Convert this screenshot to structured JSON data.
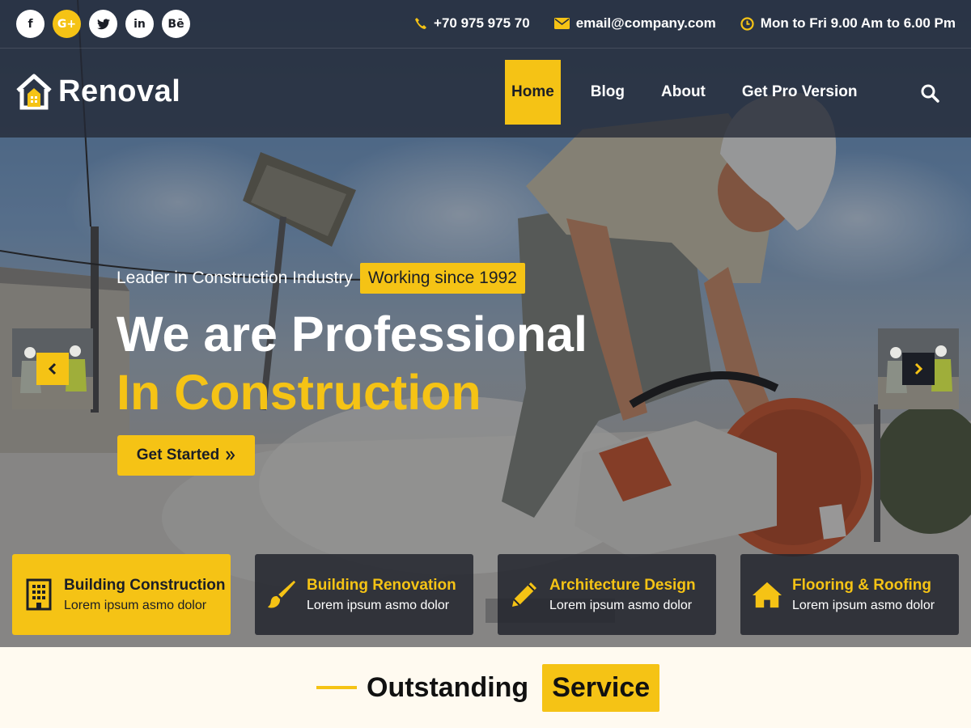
{
  "brand": {
    "name": "Renoval",
    "accent": "#f5c315",
    "dark": "#1b1e26"
  },
  "topbar": {
    "socials": [
      {
        "icon": "facebook-icon",
        "glyph": "f"
      },
      {
        "icon": "google-plus-icon",
        "glyph": "G+"
      },
      {
        "icon": "twitter-icon",
        "glyph": "t"
      },
      {
        "icon": "linkedin-icon",
        "glyph": "in"
      },
      {
        "icon": "behance-icon",
        "glyph": "Bē"
      }
    ],
    "phone": "+70 975 975 70",
    "email": "email@company.com",
    "hours": "Mon to Fri 9.00 Am to 6.00 Pm"
  },
  "nav": {
    "items": [
      {
        "label": "Home",
        "active": true
      },
      {
        "label": "Blog"
      },
      {
        "label": "About"
      },
      {
        "label": "Get Pro Version"
      }
    ]
  },
  "hero": {
    "tagline": "Leader in Construction Industry",
    "badge": "Working since 1992",
    "headline_line1": "We are Professional",
    "headline_line2": "In Construction",
    "cta_label": "Get Started"
  },
  "features": [
    {
      "title": "Building Construction",
      "desc": "Lorem ipsum asmo dolor",
      "icon": "building-icon",
      "active": true
    },
    {
      "title": "Building Renovation",
      "desc": "Lorem ipsum asmo dolor",
      "icon": "paint-brush-icon"
    },
    {
      "title": "Architecture Design",
      "desc": "Lorem ipsum asmo dolor",
      "icon": "pencil-icon"
    },
    {
      "title": "Flooring & Roofing",
      "desc": "Lorem ipsum asmo dolor",
      "icon": "house-icon"
    }
  ],
  "section": {
    "title": "Outstanding",
    "highlight": "Service"
  }
}
